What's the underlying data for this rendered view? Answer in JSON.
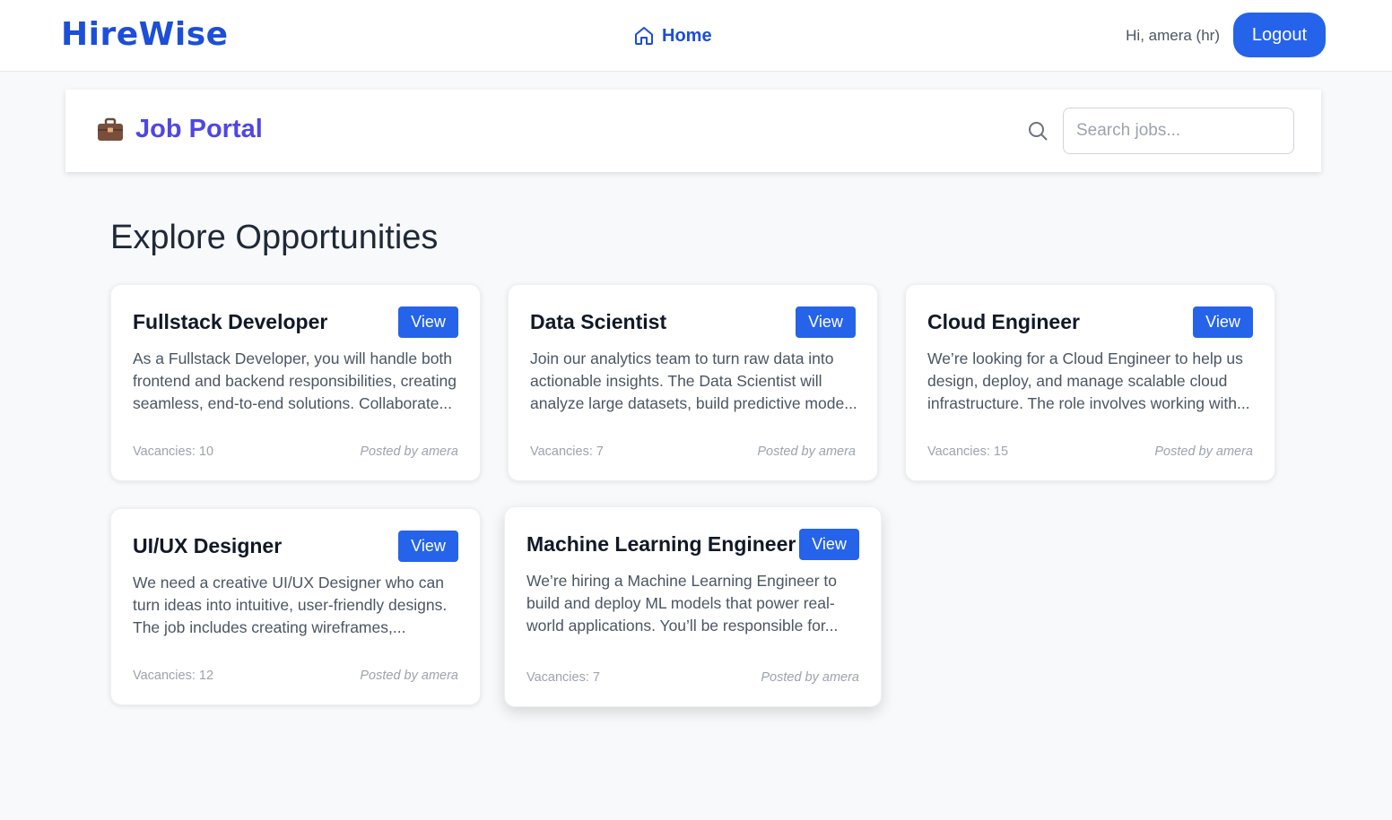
{
  "navbar": {
    "brand": "HireWise",
    "home_label": "Home",
    "greeting": "Hi, amera (hr)",
    "logout_label": "Logout"
  },
  "portal": {
    "title": "Job Portal",
    "search_placeholder": "Search jobs...",
    "search_value": ""
  },
  "section": {
    "title": "Explore Opportunities"
  },
  "jobs": [
    {
      "title": "Fullstack Developer",
      "view_label": "View",
      "description": "As a Fullstack Developer, you will handle both frontend and backend responsibilities, creating seamless, end-to-end solutions. Collaborate...",
      "vacancies": "Vacancies: 10",
      "posted_by": "Posted by amera"
    },
    {
      "title": "Data Scientist",
      "view_label": "View",
      "description": "Join our analytics team to turn raw data into actionable insights. The Data Scientist will analyze large datasets, build predictive mode...",
      "vacancies": "Vacancies: 7",
      "posted_by": "Posted by amera"
    },
    {
      "title": "Cloud Engineer",
      "view_label": "View",
      "description": "We’re looking for a Cloud Engineer to help us design, deploy, and manage scalable cloud infrastructure. The role involves working with...",
      "vacancies": "Vacancies: 15",
      "posted_by": "Posted by amera"
    },
    {
      "title": "UI/UX Designer",
      "view_label": "View",
      "description": "We need a creative UI/UX Designer who can turn ideas into intuitive, user-friendly designs. The job includes creating wireframes,...",
      "vacancies": "Vacancies: 12",
      "posted_by": "Posted by amera"
    },
    {
      "title": "Machine Learning Engineer",
      "view_label": "View",
      "description": "We’re hiring a Machine Learning Engineer to build and deploy ML models that power real-world applications. You’ll be responsible for...",
      "vacancies": "Vacancies: 7",
      "posted_by": "Posted by amera"
    }
  ],
  "icons": {
    "home": "home-icon",
    "briefcase": "briefcase-icon",
    "search": "search-icon"
  },
  "colors": {
    "brand": "#1d4ed8",
    "primary_button": "#2563eb",
    "portal_title": "#4f46e5",
    "background": "#f8f9fb"
  }
}
